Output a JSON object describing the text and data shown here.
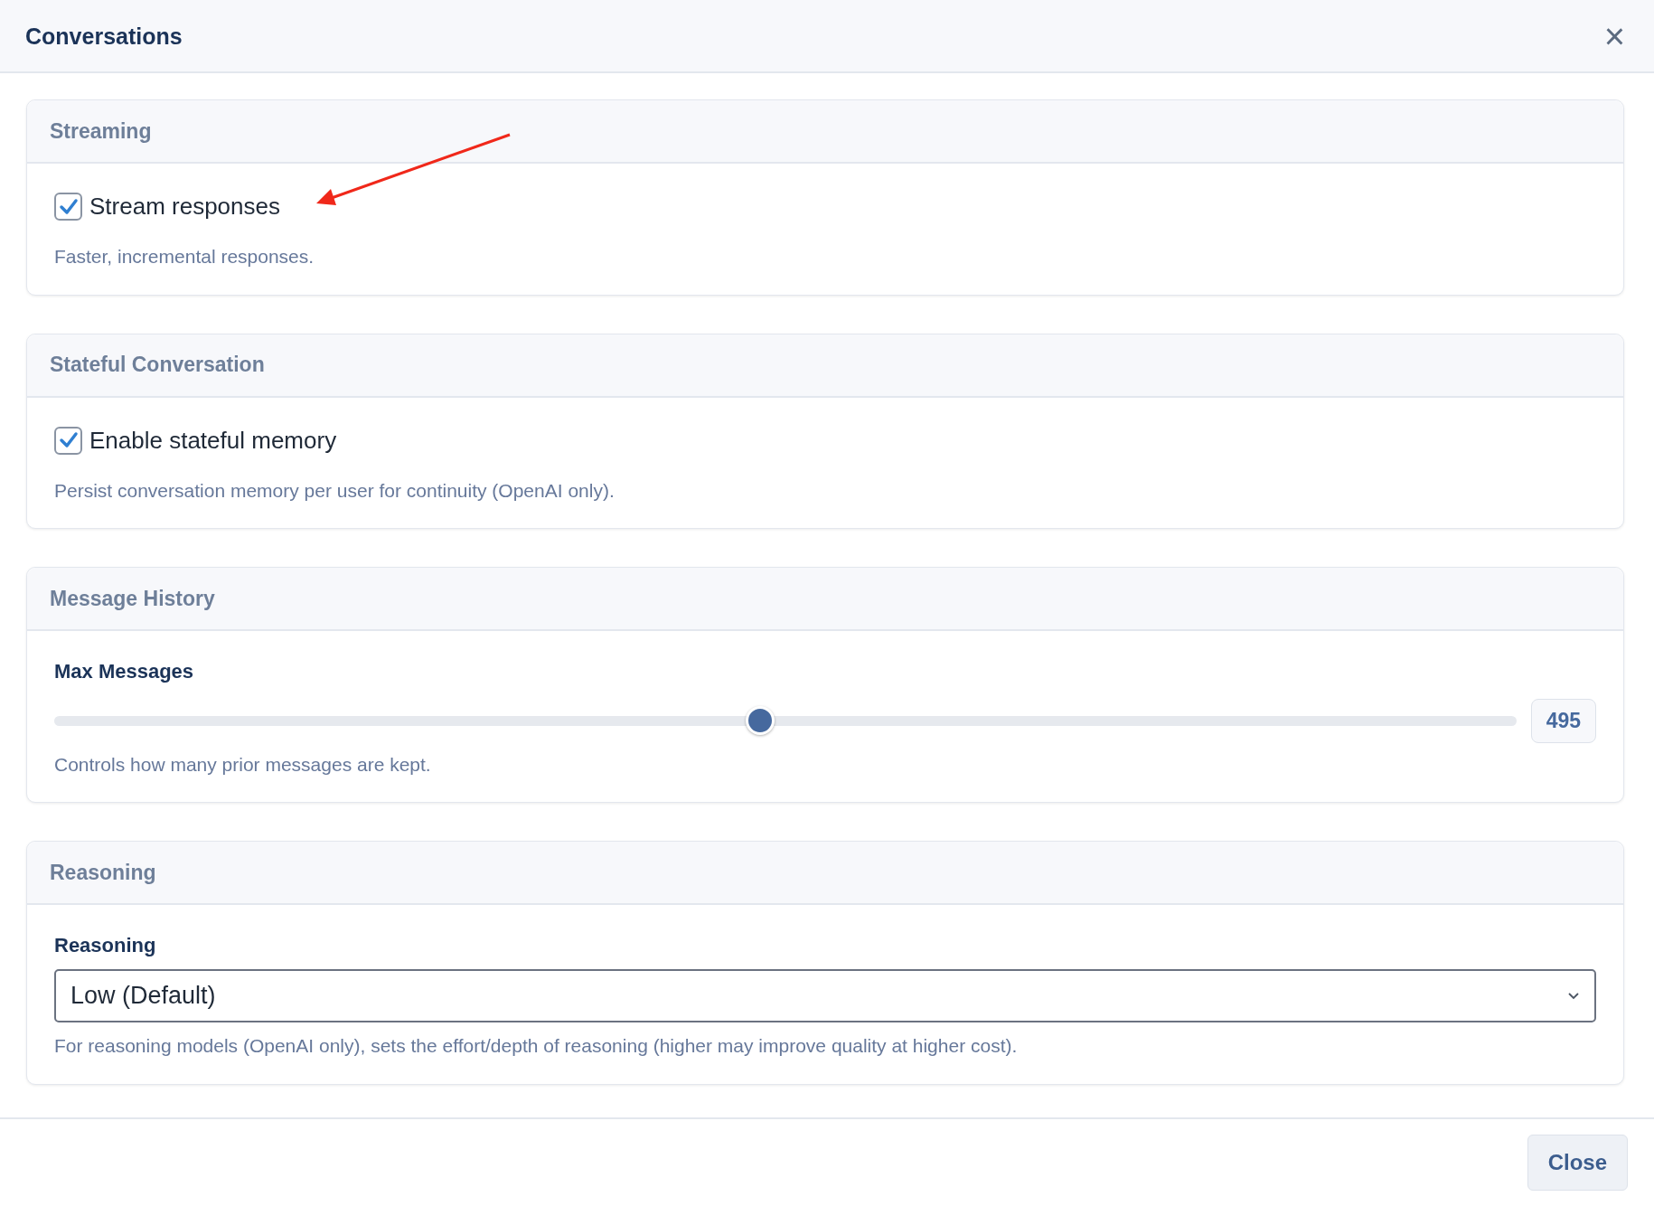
{
  "dialog": {
    "title": "Conversations",
    "close_icon": "×"
  },
  "sections": [
    {
      "title": "Streaming",
      "kind": "checkbox",
      "label": "Stream responses",
      "checked": true,
      "help": "Faster, incremental responses."
    },
    {
      "title": "Stateful Conversation",
      "kind": "checkbox",
      "label": "Enable stateful memory",
      "checked": true,
      "help": "Persist conversation memory per user for continuity (OpenAI only)."
    },
    {
      "title": "Message History",
      "kind": "slider",
      "label": "Max Messages",
      "level": 0.483,
      "reading": "495",
      "help": "Controls how many prior messages are kept."
    },
    {
      "title": "Reasoning",
      "kind": "select",
      "label": "Reasoning",
      "value": "Low (Default)",
      "help": "For reasoning models (OpenAI only), sets the effort/depth of reasoning (higher may improve quality at higher cost)."
    }
  ],
  "footer": {
    "button": "Close"
  }
}
